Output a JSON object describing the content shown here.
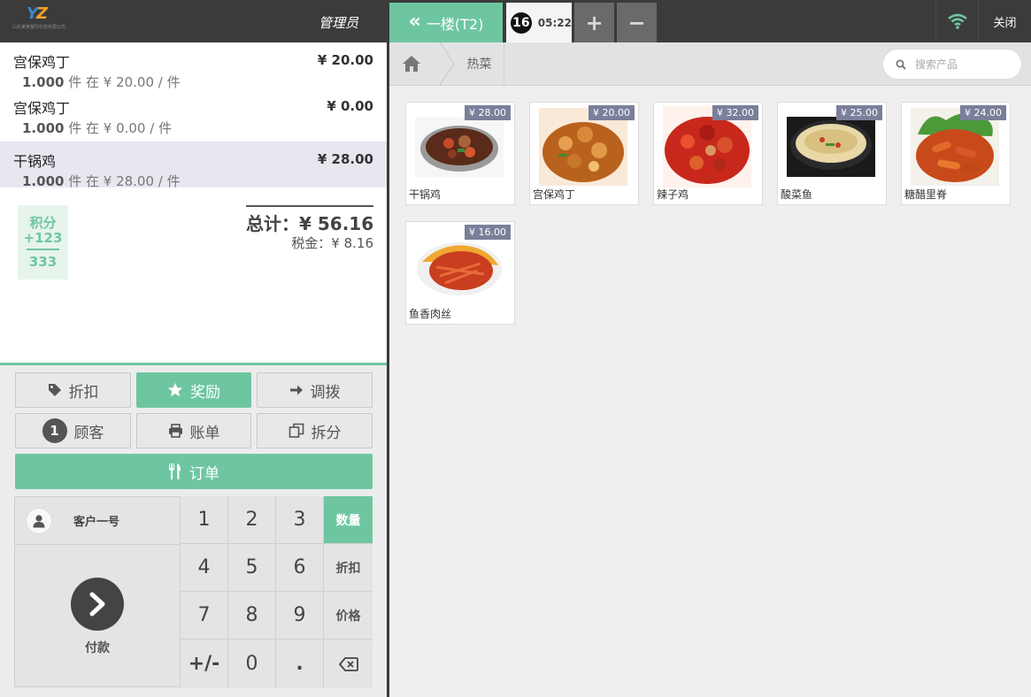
{
  "header": {
    "logo_caption": "山东某某餐饮科技有限公司",
    "user_name": "管理员",
    "floor_label": "一楼(T2)",
    "order_number": "16",
    "order_time": "05:22",
    "add_symbol": "+",
    "remove_symbol": "−",
    "close_label": "关闭"
  },
  "order": {
    "lines": [
      {
        "name": "宫保鸡丁",
        "qty": "1.000",
        "unit_text": "件 在 ¥ 20.00 / 件",
        "price": "¥ 20.00"
      },
      {
        "name": "宫保鸡丁",
        "qty": "1.000",
        "unit_text": "件 在 ¥ 0.00 / 件",
        "price": "¥ 0.00"
      },
      {
        "name": "干锅鸡",
        "qty": "1.000",
        "unit_text": "件 在 ¥ 28.00 / 件",
        "price": "¥ 28.00"
      }
    ],
    "total": "总计：¥ 56.16",
    "tax": "税金：¥ 8.16"
  },
  "loyalty": {
    "label": "积分",
    "earned": "+123",
    "balance": "333"
  },
  "actions": {
    "discount": "折扣",
    "reward": "奖励",
    "transfer": "调拨",
    "customer_count": "1",
    "customer": "顾客",
    "bill": "账单",
    "split": "拆分",
    "order": "订单"
  },
  "pad": {
    "customer_name": "客户一号",
    "pay_label": "付款",
    "keys": [
      "1",
      "2",
      "3",
      "4",
      "5",
      "6",
      "7",
      "8",
      "9",
      "+/-",
      "0",
      "."
    ],
    "modes": [
      "数量",
      "折扣",
      "价格"
    ]
  },
  "catalog": {
    "breadcrumb": "热菜",
    "search_placeholder": "搜索产品",
    "products": [
      {
        "name": "干锅鸡",
        "price": "¥ 28.00"
      },
      {
        "name": "宫保鸡丁",
        "price": "¥ 20.00"
      },
      {
        "name": "辣子鸡",
        "price": "¥ 32.00"
      },
      {
        "name": "酸菜鱼",
        "price": "¥ 25.00"
      },
      {
        "name": "糖醋里脊",
        "price": "¥ 24.00"
      },
      {
        "name": "鱼香肉丝",
        "price": "¥ 16.00"
      }
    ]
  },
  "colors": {
    "accent": "#6ec6a1",
    "topbar": "#3b3b3b",
    "price_tag": "#7a7f9a",
    "wifi": "#6ec6a1"
  }
}
